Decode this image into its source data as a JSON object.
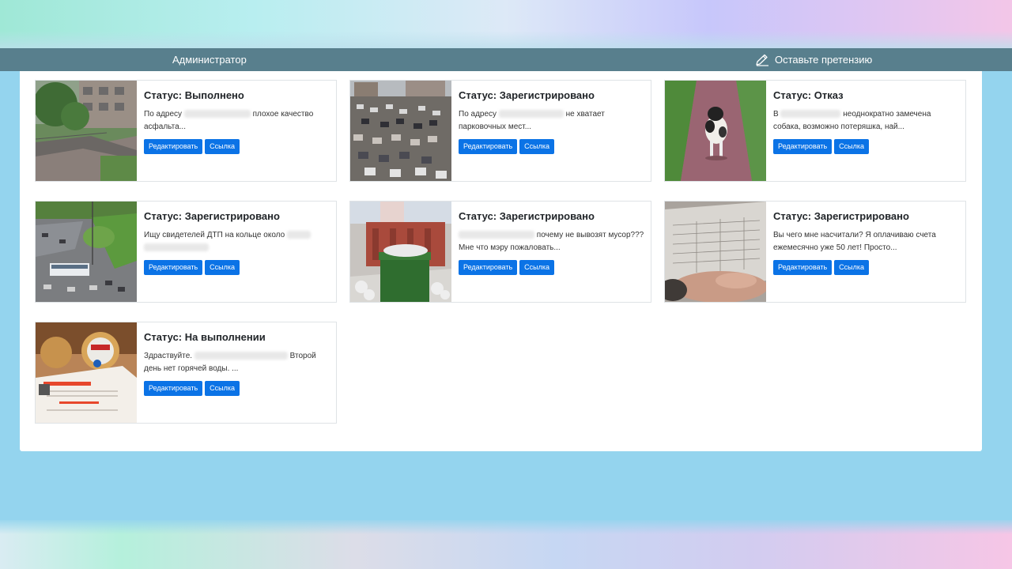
{
  "navbar": {
    "admin_label": "Администратор",
    "claim_label": "Оставьте претензию",
    "claim_icon": "pencil-icon"
  },
  "buttons": {
    "edit_label": "Редактировать",
    "link_label": "Ссылка"
  },
  "cards": [
    {
      "status": "Статус: Выполнено",
      "text_prefix": "По адресу",
      "text_suffix": "плохое качество асфальта...",
      "image": "street-photo"
    },
    {
      "status": "Статус: Зарегистрировано",
      "text_prefix": "По адресу",
      "text_suffix": "не хватает парковочных мест...",
      "image": "parking-photo"
    },
    {
      "status": "Статус: Отказ",
      "text_prefix": "В",
      "text_suffix": "неоднократно замечена собака, возможно потеряшка, най...",
      "image": "dog-photo"
    },
    {
      "status": "Статус: Зарегистрировано",
      "text_prefix": "Ищу свидетелей ДТП на кольце около",
      "text_suffix": "",
      "image": "roundabout-photo"
    },
    {
      "status": "Статус: Зарегистрировано",
      "text_prefix": "",
      "text_suffix": "почему не вывозят мусор??? Мне что мэру пожаловать...",
      "image": "trash-photo"
    },
    {
      "status": "Статус: Зарегистрировано",
      "text_prefix": "Вы чего мне насчитали? Я оплачиваю счета ежемесячно уже 50 лет! Просто...",
      "text_suffix": "",
      "image": "bill-photo"
    },
    {
      "status": "Статус: На выполнении",
      "text_prefix": "Здраствуйте.",
      "text_suffix": "Второй день нет горячей воды. ...",
      "image": "water-meter-photo"
    }
  ]
}
